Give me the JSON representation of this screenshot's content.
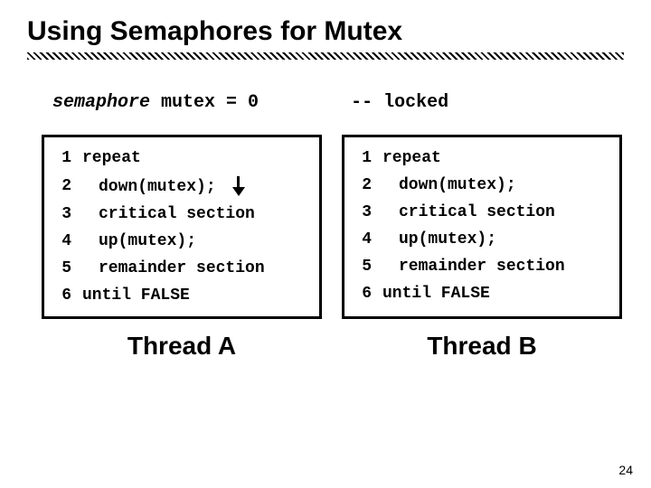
{
  "slide": {
    "title": "Using Semaphores for Mutex",
    "page_number": "24"
  },
  "headline": {
    "var_decl": "semaphore",
    "var_rest": " mutex = 0",
    "comment": "-- locked"
  },
  "code": {
    "lines": [
      {
        "n": "1",
        "text": "repeat",
        "indent": false
      },
      {
        "n": "2",
        "text": "down(mutex);",
        "indent": true
      },
      {
        "n": "3",
        "text": "critical section",
        "indent": true
      },
      {
        "n": "4",
        "text": "up(mutex);",
        "indent": true
      },
      {
        "n": "5",
        "text": "remainder section",
        "indent": true
      },
      {
        "n": "6",
        "text": "until FALSE",
        "indent": false
      }
    ]
  },
  "threads": {
    "left": "Thread A",
    "right": "Thread B"
  },
  "arrow_on_left_line": 2
}
